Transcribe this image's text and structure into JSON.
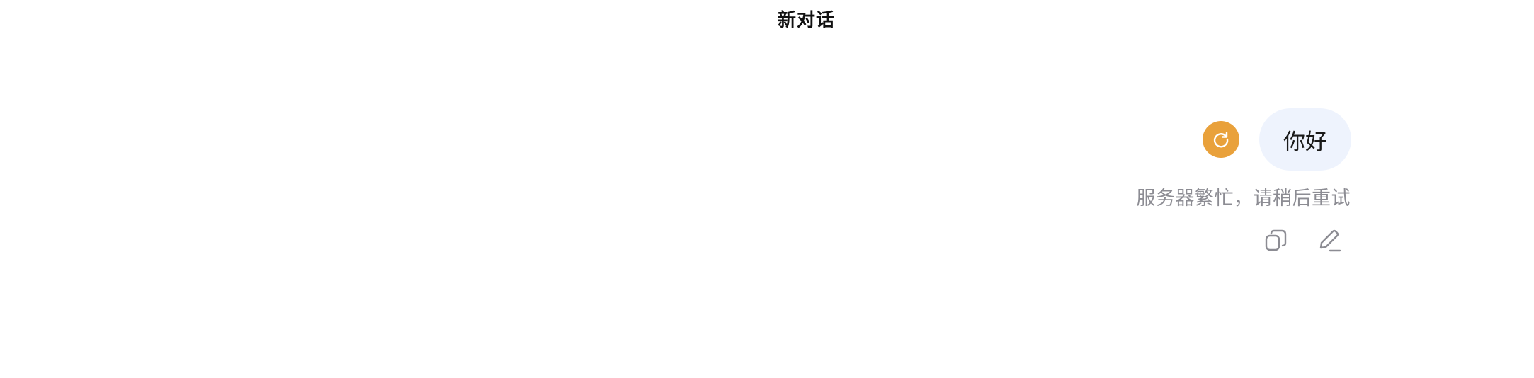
{
  "header": {
    "title": "新对话"
  },
  "message": {
    "user_text": "你好",
    "error_text": "服务器繁忙，请稍后重试",
    "retry_icon": "refresh-icon",
    "actions": [
      {
        "name": "copy",
        "icon": "copy-icon"
      },
      {
        "name": "edit",
        "icon": "edit-icon"
      }
    ]
  },
  "colors": {
    "retry_accent": "#e9a13b",
    "bubble_bg": "#eef3fd",
    "muted_text": "#8c8c93"
  }
}
